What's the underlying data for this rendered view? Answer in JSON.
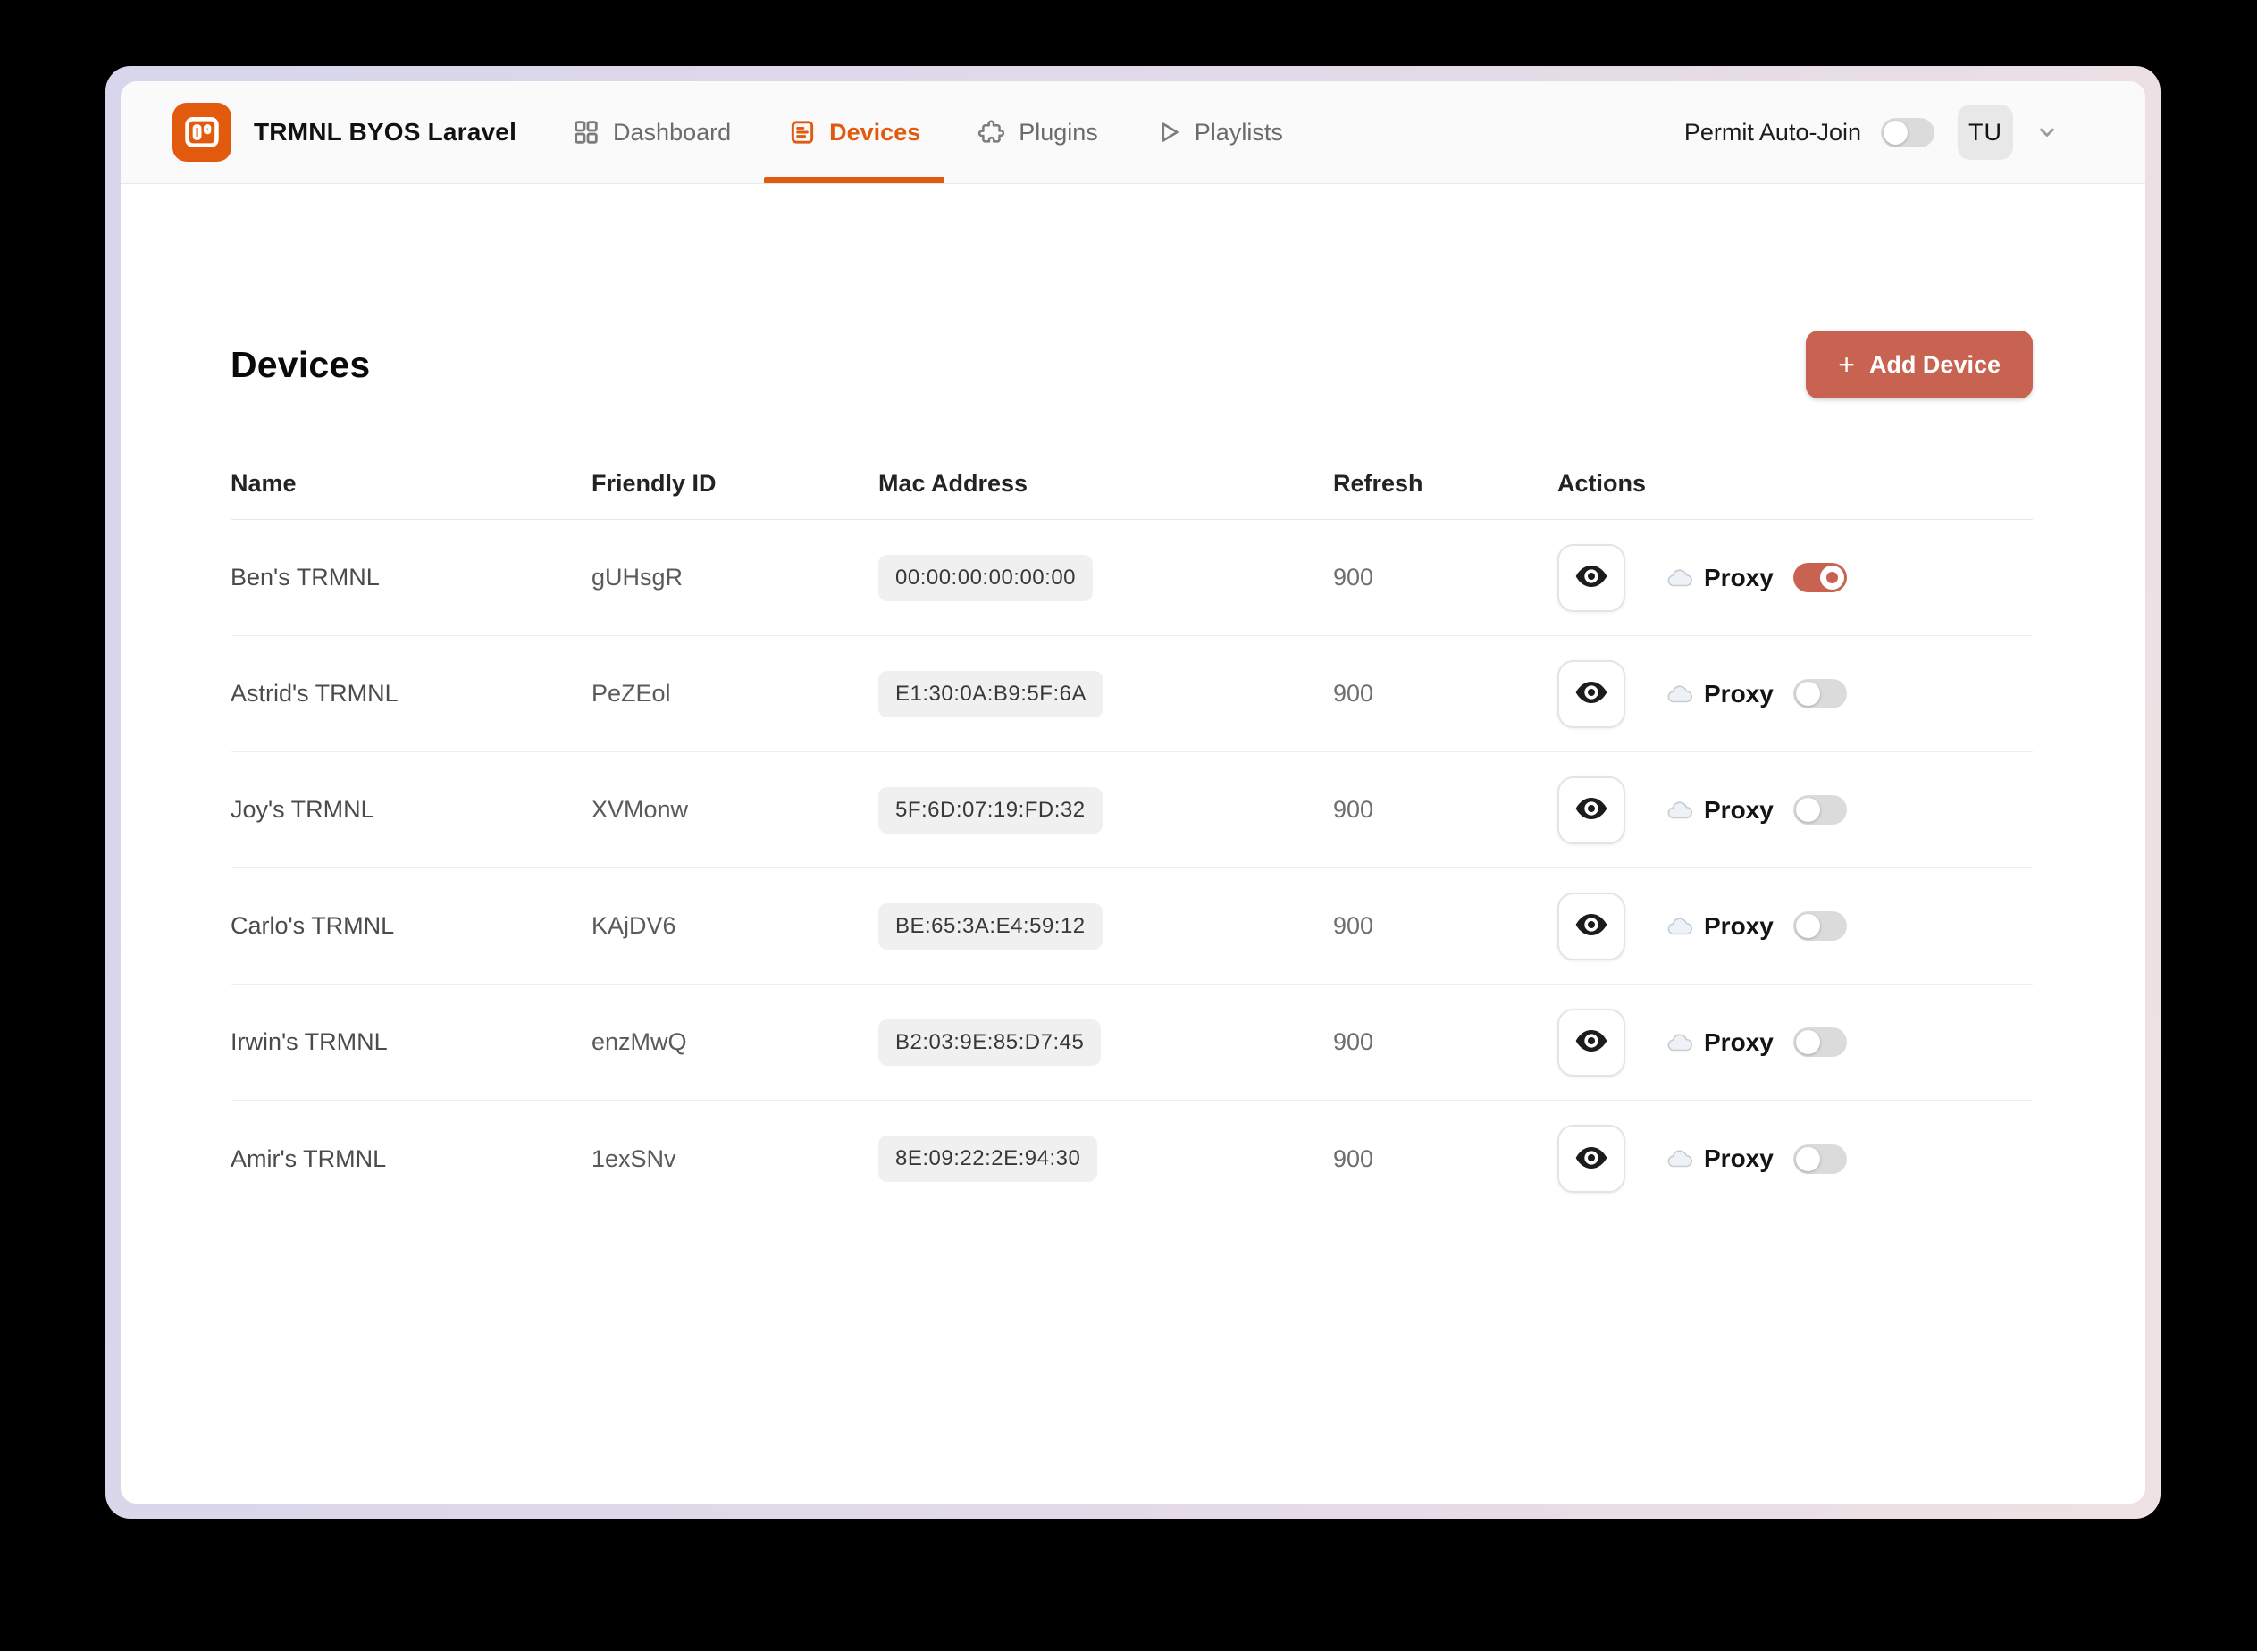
{
  "colors": {
    "brand_orange": "#e15a0d",
    "terracotta": "#c96351",
    "toggle_off": "#dbdbdb"
  },
  "header": {
    "app_title": "TRMNL BYOS Laravel",
    "nav": [
      {
        "label": "Dashboard",
        "active": false
      },
      {
        "label": "Devices",
        "active": true
      },
      {
        "label": "Plugins",
        "active": false
      },
      {
        "label": "Playlists",
        "active": false
      }
    ],
    "permit_auto_join": {
      "label": "Permit Auto-Join",
      "enabled": false
    },
    "avatar_initials": "TU"
  },
  "main": {
    "title": "Devices",
    "add_button": {
      "icon": "+",
      "label": "Add Device"
    },
    "table": {
      "columns": [
        "Name",
        "Friendly ID",
        "Mac Address",
        "Refresh",
        "Actions"
      ],
      "proxy_label": "Proxy",
      "rows": [
        {
          "name": "Ben's TRMNL",
          "friendly_id": "gUHsgR",
          "mac": "00:00:00:00:00:00",
          "refresh": "900",
          "proxy_enabled": true
        },
        {
          "name": "Astrid's TRMNL",
          "friendly_id": "PeZEol",
          "mac": "E1:30:0A:B9:5F:6A",
          "refresh": "900",
          "proxy_enabled": false
        },
        {
          "name": "Joy's TRMNL",
          "friendly_id": "XVMonw",
          "mac": "5F:6D:07:19:FD:32",
          "refresh": "900",
          "proxy_enabled": false
        },
        {
          "name": "Carlo's TRMNL",
          "friendly_id": "KAjDV6",
          "mac": "BE:65:3A:E4:59:12",
          "refresh": "900",
          "proxy_enabled": false
        },
        {
          "name": "Irwin's TRMNL",
          "friendly_id": "enzMwQ",
          "mac": "B2:03:9E:85:D7:45",
          "refresh": "900",
          "proxy_enabled": false
        },
        {
          "name": "Amir's TRMNL",
          "friendly_id": "1exSNv",
          "mac": "8E:09:22:2E:94:30",
          "refresh": "900",
          "proxy_enabled": false
        }
      ]
    }
  }
}
